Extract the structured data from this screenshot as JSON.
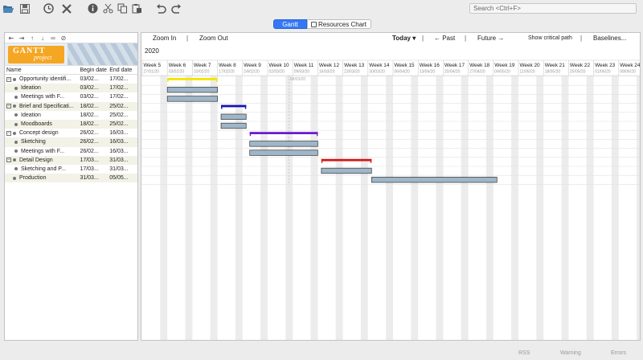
{
  "toolbar": {
    "icons": [
      "folder-open-icon",
      "save-icon",
      "history-icon",
      "close-icon",
      "info-icon",
      "cut-icon",
      "copy-icon",
      "paste-icon",
      "undo-icon",
      "redo-icon"
    ],
    "search_placeholder": "Search <Ctrl+F>"
  },
  "tabs": [
    {
      "label": "Gantt",
      "active": true
    },
    {
      "label": "Resources Chart",
      "active": false
    }
  ],
  "logo": {
    "word1": "GANTT",
    "word2": "project"
  },
  "table": {
    "headers": {
      "name": "Name",
      "begin": "Begin date",
      "end": "End date"
    },
    "rows": [
      {
        "name": "Opportunity identifi...",
        "begin": "03/02...",
        "end": "17/02...",
        "level": 0,
        "group": true
      },
      {
        "name": "Ideation",
        "begin": "03/02...",
        "end": "17/02...",
        "level": 1,
        "group": false
      },
      {
        "name": "Meetings with F...",
        "begin": "03/02...",
        "end": "17/02...",
        "level": 1,
        "group": false
      },
      {
        "name": "Brief and Specificati...",
        "begin": "18/02...",
        "end": "25/02...",
        "level": 0,
        "group": true
      },
      {
        "name": "Ideation",
        "begin": "18/02...",
        "end": "25/02...",
        "level": 1,
        "group": false
      },
      {
        "name": "Moodboards",
        "begin": "18/02...",
        "end": "25/02...",
        "level": 1,
        "group": false
      },
      {
        "name": "Concept design",
        "begin": "26/02...",
        "end": "16/03...",
        "level": 0,
        "group": true
      },
      {
        "name": "Sketching",
        "begin": "26/02...",
        "end": "16/03...",
        "level": 1,
        "group": false
      },
      {
        "name": "Meetings with F...",
        "begin": "26/02...",
        "end": "16/03...",
        "level": 1,
        "group": false
      },
      {
        "name": "Detail Design",
        "begin": "17/03...",
        "end": "31/03...",
        "level": 0,
        "group": true
      },
      {
        "name": "Sketching and P...",
        "begin": "17/03...",
        "end": "31/03...",
        "level": 1,
        "group": false
      },
      {
        "name": "Production",
        "begin": "31/03...",
        "end": "05/05...",
        "level": 0,
        "group": false
      }
    ]
  },
  "chart_toolbar": {
    "zoom_in": "Zoom In",
    "zoom_out": "Zoom Out",
    "today": "Today",
    "past": "← Past",
    "future": "Future →",
    "critical": "Show critical path",
    "baselines": "Baselines..."
  },
  "year": "2020",
  "today_marker": "08/03/20",
  "weeks": [
    {
      "label": "Week 5",
      "date": "27/01/20"
    },
    {
      "label": "Week 6",
      "date": "03/02/20"
    },
    {
      "label": "Week 7",
      "date": "10/02/20"
    },
    {
      "label": "Week 8",
      "date": "17/02/20"
    },
    {
      "label": "Week 9",
      "date": "24/02/20"
    },
    {
      "label": "Week 10",
      "date": "02/03/20"
    },
    {
      "label": "Week 11",
      "date": "09/03/20"
    },
    {
      "label": "Week 12",
      "date": "16/03/20"
    },
    {
      "label": "Week 13",
      "date": "23/03/20"
    },
    {
      "label": "Week 14",
      "date": "30/03/20"
    },
    {
      "label": "Week 15",
      "date": "06/04/20"
    },
    {
      "label": "Week 16",
      "date": "13/04/20"
    },
    {
      "label": "Week 17",
      "date": "20/04/20"
    },
    {
      "label": "Week 18",
      "date": "27/04/20"
    },
    {
      "label": "Week 19",
      "date": "04/05/20"
    },
    {
      "label": "Week 20",
      "date": "11/05/20"
    },
    {
      "label": "Week 21",
      "date": "18/05/20"
    },
    {
      "label": "Week 22",
      "date": "25/05/20"
    },
    {
      "label": "Week 23",
      "date": "01/06/20"
    },
    {
      "label": "Week 24",
      "date": "08/06/20"
    }
  ],
  "chart_start": "2020-01-27",
  "today_date": "2020-03-08",
  "tasks": [
    {
      "start": "2020-02-03",
      "end": "2020-02-17",
      "group": true,
      "color": "#f2e600"
    },
    {
      "start": "2020-02-03",
      "end": "2020-02-17",
      "group": false
    },
    {
      "start": "2020-02-03",
      "end": "2020-02-17",
      "group": false
    },
    {
      "start": "2020-02-18",
      "end": "2020-02-25",
      "group": true,
      "color": "#1414b4"
    },
    {
      "start": "2020-02-18",
      "end": "2020-02-25",
      "group": false
    },
    {
      "start": "2020-02-18",
      "end": "2020-02-25",
      "group": false
    },
    {
      "start": "2020-02-26",
      "end": "2020-03-16",
      "group": true,
      "color": "#6a1bd0"
    },
    {
      "start": "2020-02-26",
      "end": "2020-03-16",
      "group": false
    },
    {
      "start": "2020-02-26",
      "end": "2020-03-16",
      "group": false
    },
    {
      "start": "2020-03-17",
      "end": "2020-03-31",
      "group": true,
      "color": "#d01818"
    },
    {
      "start": "2020-03-17",
      "end": "2020-03-31",
      "group": false
    },
    {
      "start": "2020-03-31",
      "end": "2020-05-05",
      "group": false
    }
  ],
  "task_color": "#9fb6c8",
  "status": {
    "rss": "RSS",
    "warning": "Warning",
    "errors": "Errors"
  }
}
